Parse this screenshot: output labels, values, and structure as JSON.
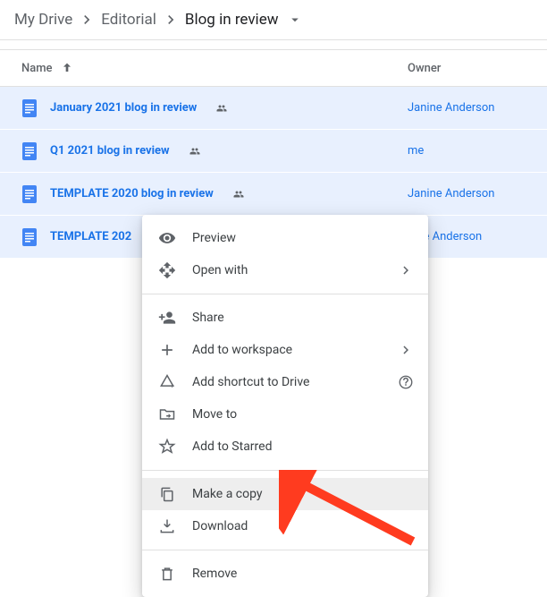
{
  "breadcrumbs": {
    "items": [
      "My Drive",
      "Editorial",
      "Blog in review"
    ]
  },
  "columns": {
    "name": "Name",
    "owner": "Owner"
  },
  "files": [
    {
      "name": "January 2021 blog in review",
      "owner": "Janine Anderson"
    },
    {
      "name": "Q1 2021 blog in review",
      "owner": "me"
    },
    {
      "name": "TEMPLATE 2020 blog in review",
      "owner": "Janine Anderson"
    },
    {
      "name": "TEMPLATE 202",
      "owner": "nine Anderson"
    }
  ],
  "menu": {
    "preview": "Preview",
    "open_with": "Open with",
    "share": "Share",
    "add_workspace": "Add to workspace",
    "add_shortcut": "Add shortcut to Drive",
    "move_to": "Move to",
    "add_starred": "Add to Starred",
    "make_copy": "Make a copy",
    "download": "Download",
    "remove": "Remove"
  }
}
